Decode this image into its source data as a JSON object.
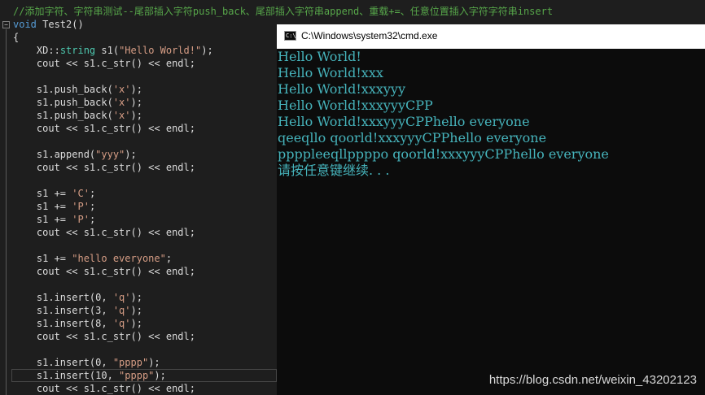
{
  "editor": {
    "lines": [
      {
        "segments": [
          {
            "t": "//添加字符、字符串测试--尾部插入字符push_back、尾部插入字符串append、重载+=、任意位置插入字符字符串insert",
            "c": "comment"
          }
        ]
      },
      {
        "segments": [
          {
            "t": "void",
            "c": "kw"
          },
          {
            "t": " Test2()",
            "c": ""
          }
        ]
      },
      {
        "segments": [
          {
            "t": "{",
            "c": ""
          }
        ]
      },
      {
        "segments": [
          {
            "t": "    XD",
            "c": ""
          },
          {
            "t": "::",
            "c": ""
          },
          {
            "t": "string",
            "c": "ns"
          },
          {
            "t": " s1(",
            "c": ""
          },
          {
            "t": "\"Hello World!\"",
            "c": "str"
          },
          {
            "t": ");",
            "c": ""
          }
        ]
      },
      {
        "segments": [
          {
            "t": "    cout << s1.c_str() << endl;",
            "c": ""
          }
        ]
      },
      {
        "segments": [
          {
            "t": "",
            "c": ""
          }
        ]
      },
      {
        "segments": [
          {
            "t": "    s1.push_back(",
            "c": ""
          },
          {
            "t": "'x'",
            "c": "str"
          },
          {
            "t": ");",
            "c": ""
          }
        ]
      },
      {
        "segments": [
          {
            "t": "    s1.push_back(",
            "c": ""
          },
          {
            "t": "'x'",
            "c": "str"
          },
          {
            "t": ");",
            "c": ""
          }
        ]
      },
      {
        "segments": [
          {
            "t": "    s1.push_back(",
            "c": ""
          },
          {
            "t": "'x'",
            "c": "str"
          },
          {
            "t": ");",
            "c": ""
          }
        ]
      },
      {
        "segments": [
          {
            "t": "    cout << s1.c_str() << endl;",
            "c": ""
          }
        ]
      },
      {
        "segments": [
          {
            "t": "",
            "c": ""
          }
        ]
      },
      {
        "segments": [
          {
            "t": "    s1.append(",
            "c": ""
          },
          {
            "t": "\"yyy\"",
            "c": "str"
          },
          {
            "t": ");",
            "c": ""
          }
        ]
      },
      {
        "segments": [
          {
            "t": "    cout << s1.c_str() << endl;",
            "c": ""
          }
        ]
      },
      {
        "segments": [
          {
            "t": "",
            "c": ""
          }
        ]
      },
      {
        "segments": [
          {
            "t": "    s1 += ",
            "c": ""
          },
          {
            "t": "'C'",
            "c": "str"
          },
          {
            "t": ";",
            "c": ""
          }
        ]
      },
      {
        "segments": [
          {
            "t": "    s1 += ",
            "c": ""
          },
          {
            "t": "'P'",
            "c": "str"
          },
          {
            "t": ";",
            "c": ""
          }
        ]
      },
      {
        "segments": [
          {
            "t": "    s1 += ",
            "c": ""
          },
          {
            "t": "'P'",
            "c": "str"
          },
          {
            "t": ";",
            "c": ""
          }
        ]
      },
      {
        "segments": [
          {
            "t": "    cout << s1.c_str() << endl;",
            "c": ""
          }
        ]
      },
      {
        "segments": [
          {
            "t": "",
            "c": ""
          }
        ]
      },
      {
        "segments": [
          {
            "t": "    s1 += ",
            "c": ""
          },
          {
            "t": "\"hello everyone\"",
            "c": "str"
          },
          {
            "t": ";",
            "c": ""
          }
        ]
      },
      {
        "segments": [
          {
            "t": "    cout << s1.c_str() << endl;",
            "c": ""
          }
        ]
      },
      {
        "segments": [
          {
            "t": "",
            "c": ""
          }
        ]
      },
      {
        "segments": [
          {
            "t": "    s1.insert(0, ",
            "c": ""
          },
          {
            "t": "'q'",
            "c": "str"
          },
          {
            "t": ");",
            "c": ""
          }
        ]
      },
      {
        "segments": [
          {
            "t": "    s1.insert(3, ",
            "c": ""
          },
          {
            "t": "'q'",
            "c": "str"
          },
          {
            "t": ");",
            "c": ""
          }
        ]
      },
      {
        "segments": [
          {
            "t": "    s1.insert(8, ",
            "c": ""
          },
          {
            "t": "'q'",
            "c": "str"
          },
          {
            "t": ");",
            "c": ""
          }
        ]
      },
      {
        "segments": [
          {
            "t": "    cout << s1.c_str() << endl;",
            "c": ""
          }
        ]
      },
      {
        "segments": [
          {
            "t": "",
            "c": ""
          }
        ]
      },
      {
        "segments": [
          {
            "t": "    s1.insert(0, ",
            "c": ""
          },
          {
            "t": "\"pppp\"",
            "c": "str"
          },
          {
            "t": ");",
            "c": ""
          }
        ]
      },
      {
        "segments": [
          {
            "t": "    s1.insert(10, ",
            "c": ""
          },
          {
            "t": "\"pppp\"",
            "c": "str"
          },
          {
            "t": ");",
            "c": ""
          }
        ]
      },
      {
        "segments": [
          {
            "t": "    cout << s1.c_str() << endl;",
            "c": ""
          }
        ]
      }
    ],
    "fold_minus": "−"
  },
  "cmd": {
    "title": "C:\\Windows\\system32\\cmd.exe",
    "icon_label": "C:\\",
    "output": [
      "Hello World!",
      "Hello World!xxx",
      "Hello World!xxxyyy",
      "Hello World!xxxyyyCPP",
      "Hello World!xxxyyyCPPhello everyone",
      "qeeqllo qoorld!xxxyyyCPPhello everyone",
      "ppppleeqllppppo qoorld!xxxyyyCPPhello everyone",
      "请按任意键继续. . ."
    ]
  },
  "watermark": "https://blog.csdn.net/weixin_43202123",
  "colors": {
    "editor_bg": "#1e1e1e",
    "comment": "#57a64a",
    "keyword": "#569cd6",
    "type": "#4ec9b0",
    "string": "#d69d85",
    "console_text": "#46b4bc",
    "console_bg": "#0c0c0c"
  }
}
